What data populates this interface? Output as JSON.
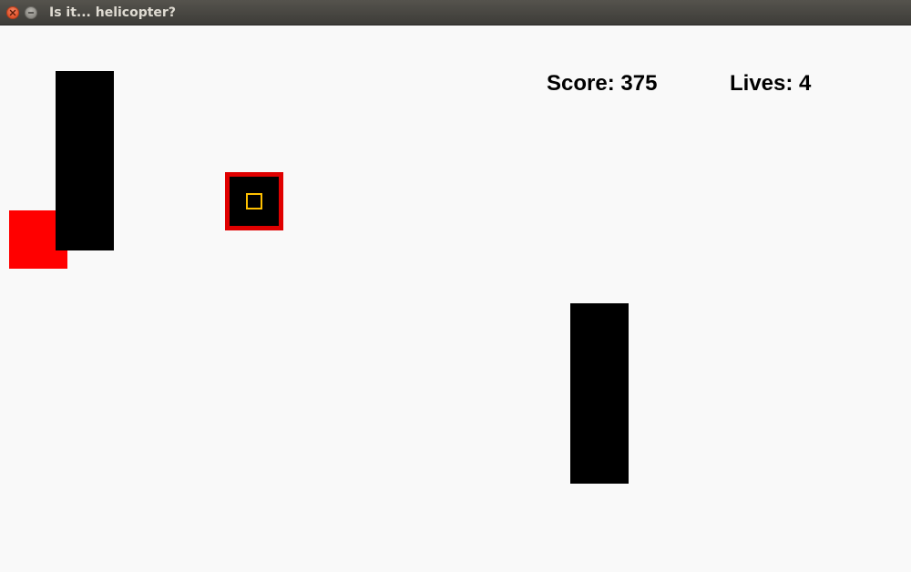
{
  "window": {
    "title": "Is it... helicopter?"
  },
  "titlebar_icons": {
    "close": "close-icon",
    "minimize": "minimize-icon"
  },
  "hud": {
    "score_label": "Score:",
    "score_value": "375",
    "lives_label": "Lives:",
    "lives_value": "4"
  },
  "colors": {
    "background": "#f9f9f9",
    "obstacle": "#000000",
    "player": "#ff0000",
    "pickup_border": "#e00000",
    "pickup_core": "#ffc000"
  }
}
